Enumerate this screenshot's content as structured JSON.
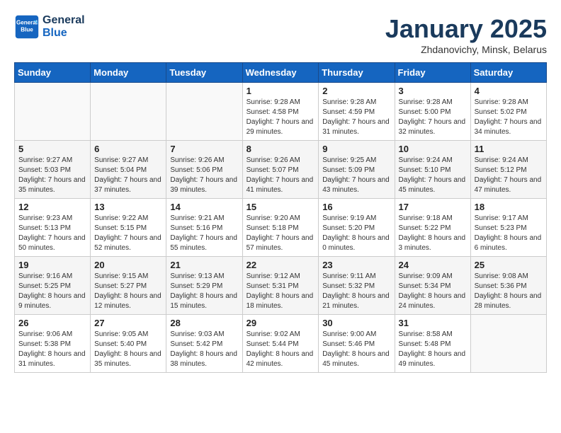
{
  "header": {
    "logo_line1": "General",
    "logo_line2": "Blue",
    "month_title": "January 2025",
    "location": "Zhdanovichy, Minsk, Belarus"
  },
  "weekdays": [
    "Sunday",
    "Monday",
    "Tuesday",
    "Wednesday",
    "Thursday",
    "Friday",
    "Saturday"
  ],
  "weeks": [
    [
      {
        "day": "",
        "info": ""
      },
      {
        "day": "",
        "info": ""
      },
      {
        "day": "",
        "info": ""
      },
      {
        "day": "1",
        "info": "Sunrise: 9:28 AM\nSunset: 4:58 PM\nDaylight: 7 hours and 29 minutes."
      },
      {
        "day": "2",
        "info": "Sunrise: 9:28 AM\nSunset: 4:59 PM\nDaylight: 7 hours and 31 minutes."
      },
      {
        "day": "3",
        "info": "Sunrise: 9:28 AM\nSunset: 5:00 PM\nDaylight: 7 hours and 32 minutes."
      },
      {
        "day": "4",
        "info": "Sunrise: 9:28 AM\nSunset: 5:02 PM\nDaylight: 7 hours and 34 minutes."
      }
    ],
    [
      {
        "day": "5",
        "info": "Sunrise: 9:27 AM\nSunset: 5:03 PM\nDaylight: 7 hours and 35 minutes."
      },
      {
        "day": "6",
        "info": "Sunrise: 9:27 AM\nSunset: 5:04 PM\nDaylight: 7 hours and 37 minutes."
      },
      {
        "day": "7",
        "info": "Sunrise: 9:26 AM\nSunset: 5:06 PM\nDaylight: 7 hours and 39 minutes."
      },
      {
        "day": "8",
        "info": "Sunrise: 9:26 AM\nSunset: 5:07 PM\nDaylight: 7 hours and 41 minutes."
      },
      {
        "day": "9",
        "info": "Sunrise: 9:25 AM\nSunset: 5:09 PM\nDaylight: 7 hours and 43 minutes."
      },
      {
        "day": "10",
        "info": "Sunrise: 9:24 AM\nSunset: 5:10 PM\nDaylight: 7 hours and 45 minutes."
      },
      {
        "day": "11",
        "info": "Sunrise: 9:24 AM\nSunset: 5:12 PM\nDaylight: 7 hours and 47 minutes."
      }
    ],
    [
      {
        "day": "12",
        "info": "Sunrise: 9:23 AM\nSunset: 5:13 PM\nDaylight: 7 hours and 50 minutes."
      },
      {
        "day": "13",
        "info": "Sunrise: 9:22 AM\nSunset: 5:15 PM\nDaylight: 7 hours and 52 minutes."
      },
      {
        "day": "14",
        "info": "Sunrise: 9:21 AM\nSunset: 5:16 PM\nDaylight: 7 hours and 55 minutes."
      },
      {
        "day": "15",
        "info": "Sunrise: 9:20 AM\nSunset: 5:18 PM\nDaylight: 7 hours and 57 minutes."
      },
      {
        "day": "16",
        "info": "Sunrise: 9:19 AM\nSunset: 5:20 PM\nDaylight: 8 hours and 0 minutes."
      },
      {
        "day": "17",
        "info": "Sunrise: 9:18 AM\nSunset: 5:22 PM\nDaylight: 8 hours and 3 minutes."
      },
      {
        "day": "18",
        "info": "Sunrise: 9:17 AM\nSunset: 5:23 PM\nDaylight: 8 hours and 6 minutes."
      }
    ],
    [
      {
        "day": "19",
        "info": "Sunrise: 9:16 AM\nSunset: 5:25 PM\nDaylight: 8 hours and 9 minutes."
      },
      {
        "day": "20",
        "info": "Sunrise: 9:15 AM\nSunset: 5:27 PM\nDaylight: 8 hours and 12 minutes."
      },
      {
        "day": "21",
        "info": "Sunrise: 9:13 AM\nSunset: 5:29 PM\nDaylight: 8 hours and 15 minutes."
      },
      {
        "day": "22",
        "info": "Sunrise: 9:12 AM\nSunset: 5:31 PM\nDaylight: 8 hours and 18 minutes."
      },
      {
        "day": "23",
        "info": "Sunrise: 9:11 AM\nSunset: 5:32 PM\nDaylight: 8 hours and 21 minutes."
      },
      {
        "day": "24",
        "info": "Sunrise: 9:09 AM\nSunset: 5:34 PM\nDaylight: 8 hours and 24 minutes."
      },
      {
        "day": "25",
        "info": "Sunrise: 9:08 AM\nSunset: 5:36 PM\nDaylight: 8 hours and 28 minutes."
      }
    ],
    [
      {
        "day": "26",
        "info": "Sunrise: 9:06 AM\nSunset: 5:38 PM\nDaylight: 8 hours and 31 minutes."
      },
      {
        "day": "27",
        "info": "Sunrise: 9:05 AM\nSunset: 5:40 PM\nDaylight: 8 hours and 35 minutes."
      },
      {
        "day": "28",
        "info": "Sunrise: 9:03 AM\nSunset: 5:42 PM\nDaylight: 8 hours and 38 minutes."
      },
      {
        "day": "29",
        "info": "Sunrise: 9:02 AM\nSunset: 5:44 PM\nDaylight: 8 hours and 42 minutes."
      },
      {
        "day": "30",
        "info": "Sunrise: 9:00 AM\nSunset: 5:46 PM\nDaylight: 8 hours and 45 minutes."
      },
      {
        "day": "31",
        "info": "Sunrise: 8:58 AM\nSunset: 5:48 PM\nDaylight: 8 hours and 49 minutes."
      },
      {
        "day": "",
        "info": ""
      }
    ]
  ]
}
